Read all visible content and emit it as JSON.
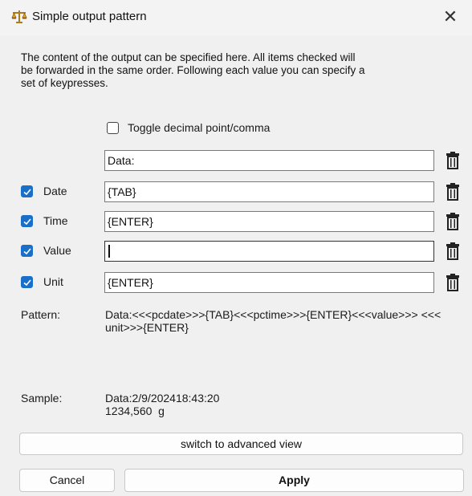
{
  "window": {
    "title": "Simple output pattern",
    "icon": "scale-icon",
    "close_glyph": "✕"
  },
  "description": "The content of the output can be specified here. All items checked will be forwarded in the same order. Following each value you can specify a set of keypresses.",
  "toggle": {
    "label": "Toggle decimal point/comma",
    "checked": false
  },
  "fields": {
    "prefix": {
      "value": "Data:"
    },
    "date": {
      "label": "Date",
      "checked": true,
      "value": "{TAB}"
    },
    "time": {
      "label": "Time",
      "checked": true,
      "value": "{ENTER}"
    },
    "value": {
      "label": "Value",
      "checked": true,
      "value": ""
    },
    "unit": {
      "label": "Unit",
      "checked": true,
      "value": "{ENTER}"
    }
  },
  "pattern": {
    "label": "Pattern:",
    "text": "Data:<<<pcdate>>>{TAB}<<<pctime>>>{ENTER}<<<value>>> <<<unit>>>{ENTER}"
  },
  "sample": {
    "label": "Sample:",
    "line1": "Data:2/9/202418:43:20",
    "line2": "1234,560  g"
  },
  "buttons": {
    "advanced": "switch to advanced view",
    "cancel": "Cancel",
    "apply": "Apply"
  },
  "colors": {
    "accent": "#1a6fc9",
    "background": "#f0f0f0"
  }
}
